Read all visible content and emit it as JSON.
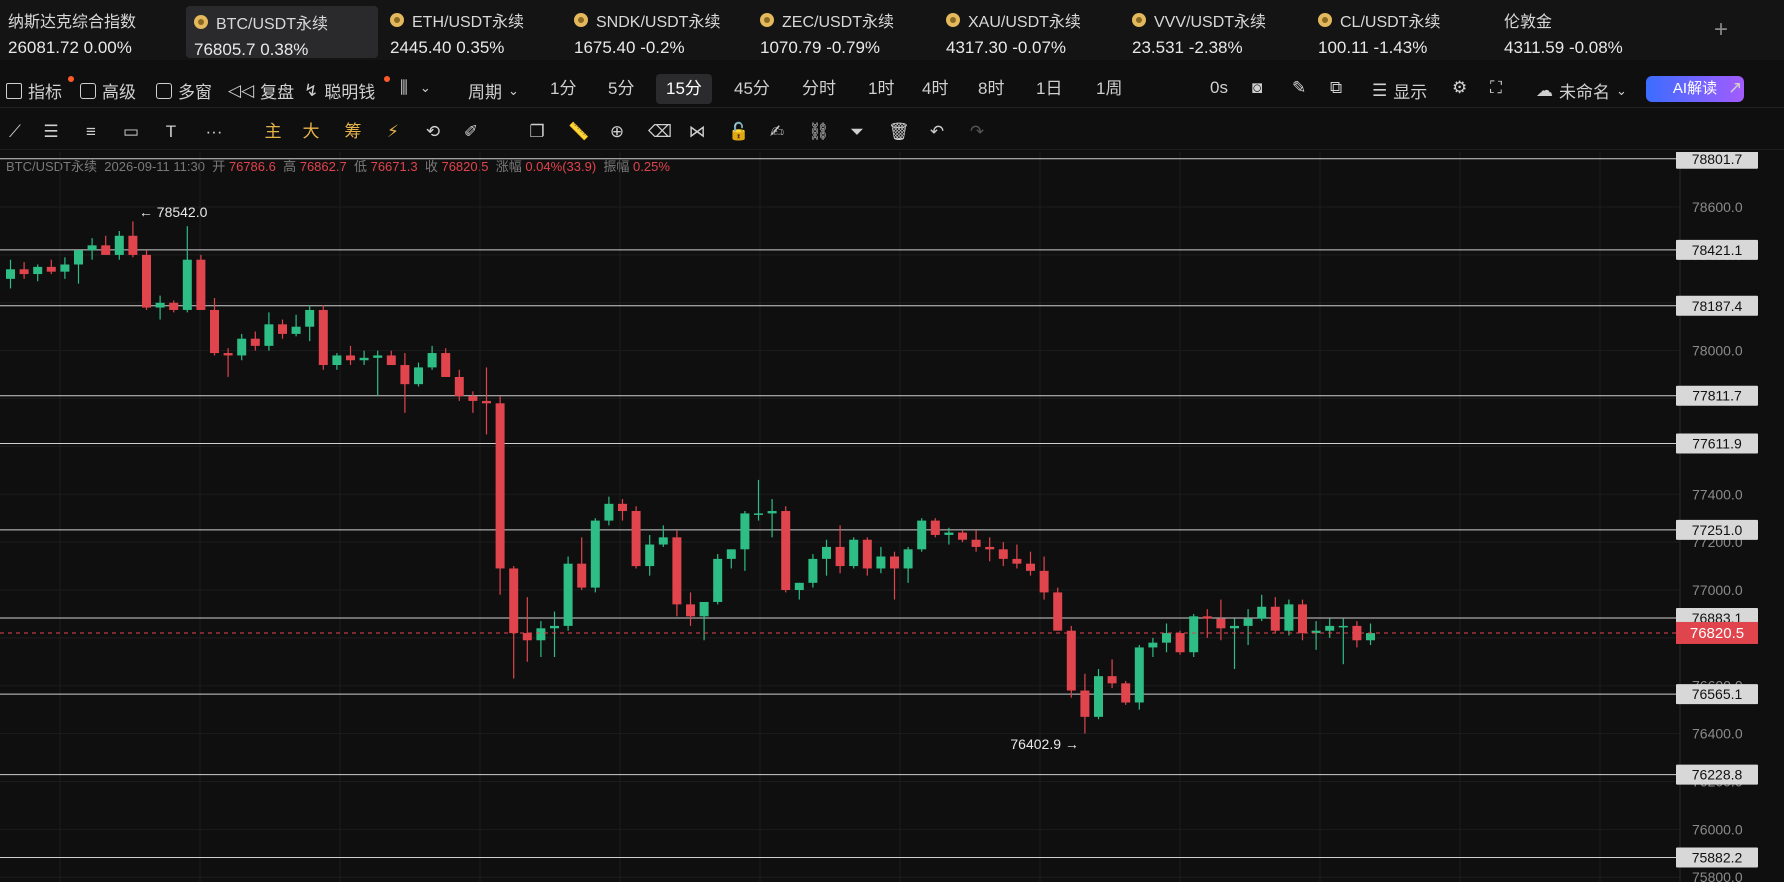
{
  "tickers": [
    {
      "name": "纳斯达克综合指数",
      "price": "26081.72",
      "change": "0.00%",
      "dir": "flat",
      "icon": false
    },
    {
      "name": "BTC/USDT永续",
      "price": "76805.7",
      "change": "0.38%",
      "dir": "flat",
      "icon": true,
      "active": true
    },
    {
      "name": "ETH/USDT永续",
      "price": "2445.40",
      "change": "0.35%",
      "dir": "flat",
      "icon": true
    },
    {
      "name": "SNDK/USDT永续",
      "price": "1675.40",
      "change": "-0.2%",
      "dir": "flat",
      "icon": true
    },
    {
      "name": "ZEC/USDT永续",
      "price": "1070.79",
      "change": "-0.79%",
      "dir": "down",
      "icon": true
    },
    {
      "name": "XAU/USDT永续",
      "price": "4317.30",
      "change": "-0.07%",
      "dir": "flat",
      "icon": true
    },
    {
      "name": "VVV/USDT永续",
      "price": "23.531",
      "change": "-2.38%",
      "dir": "flat",
      "icon": true
    },
    {
      "name": "CL/USDT永续",
      "price": "100.11",
      "change": "-1.43%",
      "dir": "up",
      "icon": true
    },
    {
      "name": "伦敦金",
      "price": "4311.59",
      "change": "-0.08%",
      "dir": "down",
      "icon": false
    }
  ],
  "ticker_add": "+",
  "toolbar": {
    "indicators": "指标",
    "advanced": "高级",
    "multi_window": "多窗",
    "replay": "复盘",
    "smart_money": "聪明钱",
    "period_label": "周期",
    "periods": [
      "1分",
      "5分",
      "15分",
      "45分",
      "分时",
      "1时",
      "4时",
      "8时",
      "1日",
      "1周"
    ],
    "active_period": "15分",
    "countdown": "0s",
    "display": "显示",
    "layout_name": "未命名",
    "ai_label": "AI解读"
  },
  "draw_toolbar": {
    "main": "主",
    "large": "大",
    "chips": "筹"
  },
  "ohlc": {
    "symbol": "BTC/USDT永续",
    "time": "2026-09-11 11:30",
    "open_label": "开",
    "open": "76786.6",
    "high_label": "高",
    "high": "76862.7",
    "low_label": "低",
    "low": "76671.3",
    "close_label": "收",
    "close": "76820.5",
    "change_label": "涨幅",
    "change": "0.04%(33.9)",
    "amp_label": "振幅",
    "amp": "0.25%"
  },
  "colors": {
    "up": "#2ebd85",
    "down": "#e0444c",
    "bg": "#0f0f10",
    "accent": "#e6b34a"
  },
  "chart_data": {
    "type": "candlestick",
    "interval": "15分",
    "y_ticks": [
      78600,
      78400,
      78200,
      78000,
      77800,
      77600,
      77400,
      77200,
      77000,
      76800,
      76600,
      76400,
      76200,
      76000,
      75800
    ],
    "ylim": [
      75780,
      78830
    ],
    "horizontal_levels": [
      78801.7,
      78421.1,
      78187.4,
      77811.7,
      77611.9,
      77251.0,
      76883.1,
      76565.1,
      76228.8,
      75882.2
    ],
    "current_price": 76820.5,
    "annotations": [
      {
        "label": "← 78542.0",
        "value": 78542.0
      },
      {
        "label": "76402.9 →",
        "value": 76402.9
      }
    ],
    "candles": [
      [
        78300,
        78380,
        78260,
        78340
      ],
      [
        78340,
        78370,
        78300,
        78320
      ],
      [
        78320,
        78360,
        78290,
        78350
      ],
      [
        78350,
        78380,
        78320,
        78330
      ],
      [
        78330,
        78390,
        78300,
        78360
      ],
      [
        78360,
        78420,
        78280,
        78420
      ],
      [
        78420,
        78470,
        78380,
        78440
      ],
      [
        78440,
        78480,
        78410,
        78400
      ],
      [
        78400,
        78500,
        78380,
        78480
      ],
      [
        78480,
        78540,
        78390,
        78400
      ],
      [
        78400,
        78420,
        78170,
        78180
      ],
      [
        78180,
        78230,
        78130,
        78200
      ],
      [
        78200,
        78210,
        78160,
        78170
      ],
      [
        78170,
        78520,
        78160,
        78380
      ],
      [
        78380,
        78400,
        78170,
        78170
      ],
      [
        78170,
        78220,
        77980,
        77990
      ],
      [
        77990,
        78010,
        77890,
        77980
      ],
      [
        77980,
        78070,
        77960,
        78050
      ],
      [
        78050,
        78080,
        78000,
        78020
      ],
      [
        78020,
        78160,
        78000,
        78110
      ],
      [
        78110,
        78130,
        78050,
        78070
      ],
      [
        78070,
        78150,
        78060,
        78100
      ],
      [
        78100,
        78190,
        78040,
        78170
      ],
      [
        78170,
        78190,
        77920,
        77940
      ],
      [
        77940,
        77990,
        77920,
        77980
      ],
      [
        77980,
        78020,
        77940,
        77960
      ],
      [
        77960,
        78000,
        77940,
        77970
      ],
      [
        77970,
        78000,
        77810,
        77980
      ],
      [
        77980,
        78000,
        77940,
        77940
      ],
      [
        77940,
        77990,
        77740,
        77860
      ],
      [
        77860,
        77950,
        77850,
        77930
      ],
      [
        77930,
        78020,
        77920,
        77990
      ],
      [
        77990,
        78010,
        77900,
        77890
      ],
      [
        77890,
        77920,
        77790,
        77810
      ],
      [
        77810,
        77830,
        77740,
        77790
      ],
      [
        77790,
        77930,
        77650,
        77780
      ],
      [
        77780,
        77810,
        76980,
        77090
      ],
      [
        77090,
        77100,
        76630,
        76820
      ],
      [
        76820,
        76970,
        76700,
        76790
      ],
      [
        76790,
        76870,
        76720,
        76840
      ],
      [
        76840,
        76910,
        76720,
        76850
      ],
      [
        76850,
        77140,
        76830,
        77110
      ],
      [
        77110,
        77220,
        77000,
        77010
      ],
      [
        77010,
        77300,
        76990,
        77290
      ],
      [
        77290,
        77390,
        77270,
        77360
      ],
      [
        77360,
        77380,
        77290,
        77330
      ],
      [
        77330,
        77350,
        77090,
        77100
      ],
      [
        77100,
        77230,
        77060,
        77190
      ],
      [
        77190,
        77270,
        77180,
        77220
      ],
      [
        77220,
        77250,
        76890,
        76940
      ],
      [
        76940,
        76990,
        76850,
        76890
      ],
      [
        76890,
        76950,
        76790,
        76950
      ],
      [
        76950,
        77150,
        76940,
        77130
      ],
      [
        77130,
        77170,
        77090,
        77170
      ],
      [
        77170,
        77330,
        77080,
        77320
      ],
      [
        77320,
        77460,
        77290,
        77320
      ],
      [
        77320,
        77380,
        77220,
        77330
      ],
      [
        77330,
        77350,
        76990,
        77000
      ],
      [
        77000,
        77030,
        76960,
        77030
      ],
      [
        77030,
        77150,
        77010,
        77130
      ],
      [
        77130,
        77210,
        77060,
        77180
      ],
      [
        77180,
        77270,
        77070,
        77100
      ],
      [
        77100,
        77220,
        77090,
        77210
      ],
      [
        77210,
        77220,
        77060,
        77090
      ],
      [
        77090,
        77180,
        77070,
        77140
      ],
      [
        77140,
        77160,
        76960,
        77090
      ],
      [
        77090,
        77180,
        77030,
        77170
      ],
      [
        77170,
        77300,
        77160,
        77290
      ],
      [
        77290,
        77300,
        77220,
        77230
      ],
      [
        77230,
        77260,
        77190,
        77240
      ],
      [
        77240,
        77250,
        77200,
        77210
      ],
      [
        77210,
        77250,
        77160,
        77180
      ],
      [
        77180,
        77220,
        77120,
        77170
      ],
      [
        77170,
        77200,
        77100,
        77130
      ],
      [
        77130,
        77190,
        77090,
        77110
      ],
      [
        77110,
        77160,
        77060,
        77080
      ],
      [
        77080,
        77140,
        76960,
        76990
      ],
      [
        76990,
        77010,
        76840,
        76830
      ],
      [
        76830,
        76850,
        76550,
        76580
      ],
      [
        76580,
        76650,
        76400,
        76470
      ],
      [
        76470,
        76670,
        76460,
        76640
      ],
      [
        76640,
        76710,
        76590,
        76610
      ],
      [
        76610,
        76620,
        76520,
        76530
      ],
      [
        76530,
        76770,
        76500,
        76760
      ],
      [
        76760,
        76800,
        76720,
        76780
      ],
      [
        76780,
        76860,
        76740,
        76820
      ],
      [
        76820,
        76830,
        76730,
        76740
      ],
      [
        76740,
        76900,
        76720,
        76890
      ],
      [
        76890,
        76920,
        76800,
        76880
      ],
      [
        76880,
        76960,
        76790,
        76840
      ],
      [
        76840,
        76880,
        76670,
        76850
      ],
      [
        76850,
        76920,
        76770,
        76880
      ],
      [
        76880,
        76980,
        76870,
        76930
      ],
      [
        76930,
        76970,
        76820,
        76830
      ],
      [
        76830,
        76960,
        76810,
        76940
      ],
      [
        76940,
        76960,
        76790,
        76820
      ],
      [
        76820,
        76870,
        76750,
        76830
      ],
      [
        76830,
        76880,
        76800,
        76850
      ],
      [
        76850,
        76880,
        76690,
        76850
      ],
      [
        76850,
        76870,
        76760,
        76790
      ],
      [
        76790,
        76860,
        76770,
        76820
      ]
    ]
  }
}
